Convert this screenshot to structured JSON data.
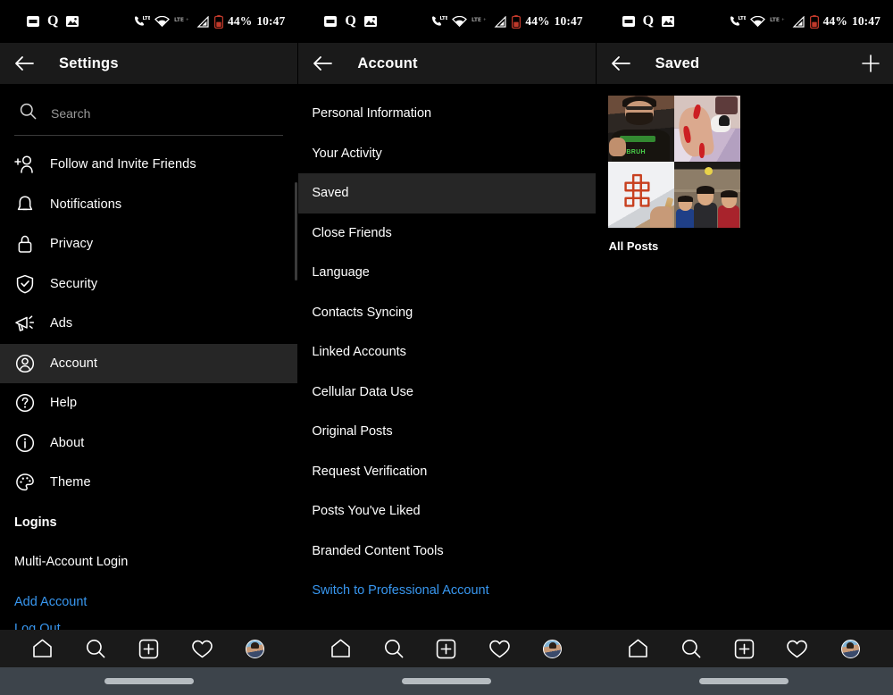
{
  "statusbar": {
    "battery": "44%",
    "time": "10:47",
    "network_left": "LTE",
    "network_right": "LTE",
    "icons": [
      "notification-badge-icon",
      "quora-q-icon",
      "photo-icon",
      "phone-lte-icon",
      "wifi-icon",
      "lte-label-icon",
      "signal-icon",
      "battery-icon"
    ]
  },
  "settings_panel": {
    "title": "Settings",
    "back_icon": "back-arrow-icon",
    "search": {
      "placeholder": "Search",
      "icon": "search-icon",
      "value": ""
    },
    "items": [
      {
        "label": "Follow and Invite Friends",
        "icon": "add-person-icon",
        "selected": false
      },
      {
        "label": "Notifications",
        "icon": "bell-icon",
        "selected": false
      },
      {
        "label": "Privacy",
        "icon": "lock-icon",
        "selected": false
      },
      {
        "label": "Security",
        "icon": "shield-check-icon",
        "selected": false
      },
      {
        "label": "Ads",
        "icon": "megaphone-icon",
        "selected": false
      },
      {
        "label": "Account",
        "icon": "person-circle-icon",
        "selected": true
      },
      {
        "label": "Help",
        "icon": "question-circle-icon",
        "selected": false
      },
      {
        "label": "About",
        "icon": "info-circle-icon",
        "selected": false
      },
      {
        "label": "Theme",
        "icon": "palette-icon",
        "selected": false
      }
    ],
    "section_header": "Logins",
    "multi_account": "Multi-Account Login",
    "add_account": "Add Account",
    "clipped_link": "Log Out"
  },
  "account_panel": {
    "title": "Account",
    "back_icon": "back-arrow-icon",
    "items": [
      {
        "label": "Personal Information",
        "selected": false,
        "link": false
      },
      {
        "label": "Your Activity",
        "selected": false,
        "link": false
      },
      {
        "label": "Saved",
        "selected": true,
        "link": false
      },
      {
        "label": "Close Friends",
        "selected": false,
        "link": false
      },
      {
        "label": "Language",
        "selected": false,
        "link": false
      },
      {
        "label": "Contacts Syncing",
        "selected": false,
        "link": false
      },
      {
        "label": "Linked Accounts",
        "selected": false,
        "link": false
      },
      {
        "label": "Cellular Data Use",
        "selected": false,
        "link": false
      },
      {
        "label": "Original Posts",
        "selected": false,
        "link": false
      },
      {
        "label": "Request Verification",
        "selected": false,
        "link": false
      },
      {
        "label": "Posts You've Liked",
        "selected": false,
        "link": false
      },
      {
        "label": "Branded Content Tools",
        "selected": false,
        "link": false
      },
      {
        "label": "Switch to Professional Account",
        "selected": false,
        "link": true
      }
    ]
  },
  "saved_panel": {
    "title": "Saved",
    "back_icon": "back-arrow-icon",
    "add_icon": "plus-icon",
    "collection_label": "All Posts",
    "thumbnails": [
      "man-with-glasses-bruh-shirt",
      "red-nails-hand-with-cat",
      "endless-knot-drawing",
      "three-cartoon-characters"
    ]
  },
  "bottom_nav": {
    "items": [
      {
        "icon": "home-icon",
        "label": "Home"
      },
      {
        "icon": "search-icon",
        "label": "Search"
      },
      {
        "icon": "add-post-icon",
        "label": "Add"
      },
      {
        "icon": "heart-icon",
        "label": "Activity"
      },
      {
        "icon": "profile-avatar-icon",
        "label": "Profile"
      }
    ]
  },
  "gesture_bar": {
    "handle": "gesture-pill"
  },
  "colors": {
    "background": "#000000",
    "header": "#1a1a1a",
    "selected_row": "#262626",
    "link": "#3897f0",
    "text": "#ffffff",
    "muted": "#9a9a9a",
    "gesture_bar": "#3d444b"
  }
}
